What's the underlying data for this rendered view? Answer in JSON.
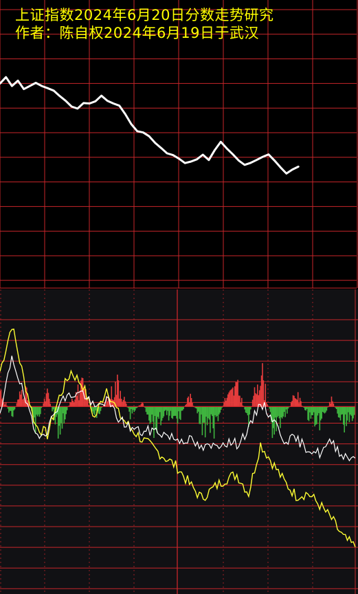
{
  "header": {
    "title": "上证指数2024年6月20日分数走势研究",
    "subtitle": "作者：陈自权2024年6月19日于武汉"
  },
  "colors": {
    "background": "#000000",
    "lower_background": "#111114",
    "grid": "#c8262a",
    "price_line": "#ffffff",
    "title_text": "#ffff00",
    "yellow_line": "#ffff33",
    "white_line": "#ffffff",
    "bar_up": "#e43c3c",
    "bar_down": "#3fb43f"
  },
  "chart_data": [
    {
      "type": "line",
      "title": "",
      "xlabel": "",
      "ylabel": "",
      "grid": true,
      "x": [
        0,
        2,
        4,
        6,
        8,
        10,
        12,
        14,
        16,
        18,
        20,
        22,
        24,
        26,
        28,
        30,
        32,
        34,
        36,
        38,
        40,
        42,
        44,
        46,
        48,
        50,
        52,
        54,
        56,
        58,
        60,
        62,
        64,
        66,
        68,
        70,
        72,
        74,
        76,
        78,
        80,
        82,
        84,
        86,
        88,
        90,
        92,
        94,
        96,
        98,
        100,
        102,
        104,
        106,
        108,
        110,
        112,
        114,
        116,
        118,
        120
      ],
      "series": [
        {
          "name": "",
          "values": [
            92.3,
            95.2,
            91.2,
            93.6,
            89.8,
            91.2,
            92.6,
            91.2,
            90.2,
            89.1,
            86.7,
            84.5,
            81.9,
            81.0,
            83.5,
            83.3,
            84.3,
            86.8,
            84.5,
            83.3,
            82.3,
            78.5,
            74.0,
            70.8,
            70.2,
            68.5,
            65.5,
            63.2,
            60.8,
            60.0,
            58.4,
            56.4,
            57.1,
            58.1,
            60.2,
            57.8,
            62.3,
            66.0,
            63.0,
            60.4,
            57.6,
            55.6,
            56.5,
            57.8,
            59.2,
            60.3,
            57.6,
            54.5,
            51.7,
            53.5,
            54.8
          ]
        }
      ],
      "ylim": [
        0,
        130
      ]
    },
    {
      "type": "bar",
      "title": "",
      "xlabel": "",
      "ylabel": "",
      "grid": true,
      "x": [
        0,
        4,
        8,
        12,
        16,
        20,
        24,
        28,
        32,
        36,
        40,
        44,
        48,
        52,
        56,
        60,
        64,
        68,
        72,
        76,
        80,
        84,
        88,
        92,
        96,
        100,
        104,
        108,
        112,
        116,
        120
      ],
      "series": [
        {
          "name": "",
          "values": [
            1.5,
            3.5,
            1.2,
            -0.8,
            -1.2,
            0.4,
            1.5,
            0.9,
            -0.5,
            0.8,
            -0.3,
            -0.9,
            -1.4,
            -1.8,
            -2.2,
            -2.6,
            -3.3,
            -3.9,
            -3.5,
            -3.1,
            -2.9,
            -3.7,
            -1.6,
            -2.4,
            -3.2,
            -3.8,
            -3.7,
            -4.2,
            -4.8,
            -5.6,
            -6.0
          ]
        },
        {
          "name": "",
          "values": [
            -0.5,
            2.2,
            0.5,
            -1.2,
            -1.0,
            0.2,
            0.5,
            0.6,
            -0.1,
            0.3,
            -0.5,
            -0.9,
            -1.1,
            -1.0,
            -1.2,
            -1.4,
            -1.4,
            -1.8,
            -1.7,
            -1.5,
            -1.6,
            -1.0,
            0.2,
            -0.5,
            -1.4,
            -1.4,
            -1.8,
            -2.0,
            -1.5,
            -2.1,
            -2.2
          ]
        },
        {
          "name": "",
          "values": [
            0.8,
            -0.5,
            1.0,
            -0.8,
            0.6,
            -1.2,
            0.4,
            0.9,
            -0.6,
            0.3,
            1.1,
            -0.4,
            0.2,
            -0.9,
            -0.3,
            -0.7,
            0.5,
            -0.8,
            -1.1,
            0.3,
            0.9,
            -0.6,
            1.8,
            -0.9,
            -0.5,
            0.6,
            -0.4,
            -0.7,
            0.3,
            -0.8,
            -0.4
          ]
        }
      ],
      "ylim": [
        -8,
        5
      ]
    }
  ]
}
